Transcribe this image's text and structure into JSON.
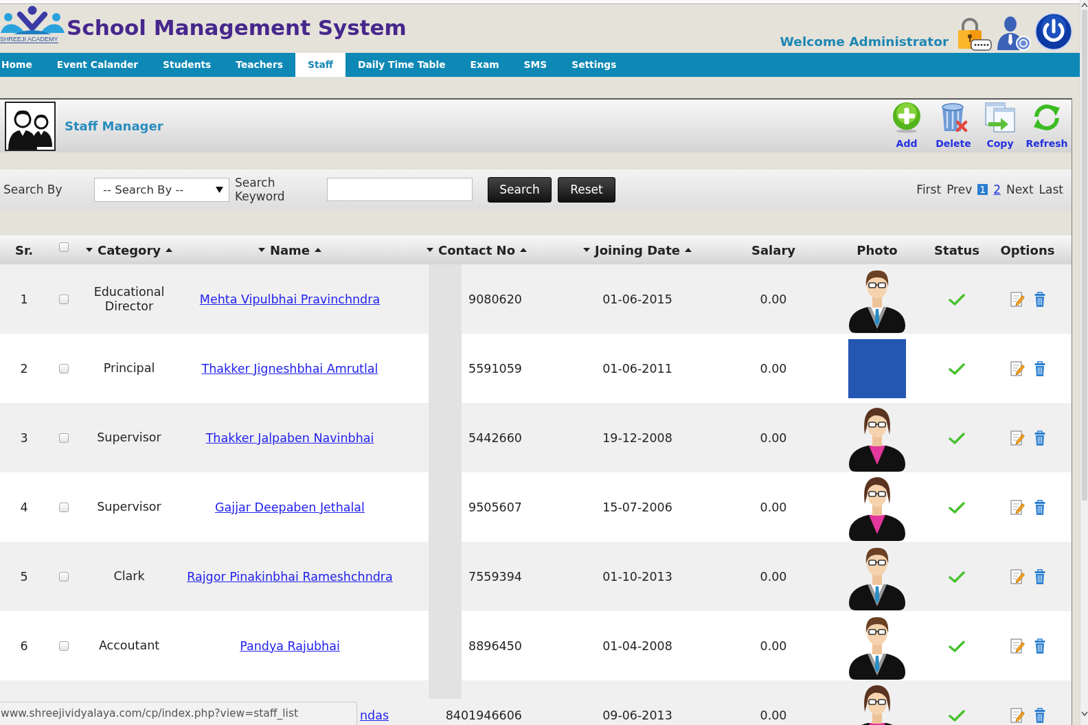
{
  "header": {
    "logo_text": "SHREEJI ACADEMY",
    "title": "School Management System",
    "welcome": "Welcome Administrator"
  },
  "nav": [
    {
      "label": "Home",
      "selected": false
    },
    {
      "label": "Event Calander",
      "selected": false
    },
    {
      "label": "Students",
      "selected": false
    },
    {
      "label": "Teachers",
      "selected": false
    },
    {
      "label": "Staff",
      "selected": true
    },
    {
      "label": "Daily Time Table",
      "selected": false
    },
    {
      "label": "Exam",
      "selected": false
    },
    {
      "label": "SMS",
      "selected": false
    },
    {
      "label": "Settings",
      "selected": false
    }
  ],
  "panel": {
    "title": "Staff Manager",
    "actions": [
      {
        "kind": "add",
        "label": "Add"
      },
      {
        "kind": "delete",
        "label": "Delete"
      },
      {
        "kind": "copy",
        "label": "Copy"
      },
      {
        "kind": "refresh",
        "label": "Refresh"
      }
    ]
  },
  "search": {
    "label": "Search By",
    "select": "-- Search By --",
    "keyword_label": "Search Keyword",
    "buttons": [
      {
        "kind": "search",
        "label": "Search"
      },
      {
        "kind": "reset",
        "label": "Reset"
      }
    ]
  },
  "pagination": {
    "first": "First",
    "prev": "Prev",
    "pages": [
      {
        "label": "1",
        "selected": true
      },
      {
        "label": "2",
        "selected": false
      }
    ],
    "next": "Next",
    "last": "Last"
  },
  "table": {
    "columns": [
      {
        "kind": "text",
        "label": "Sr.",
        "sortable": false
      },
      {
        "kind": "checkbox",
        "checked": false
      },
      {
        "kind": "text",
        "label": "Category",
        "sortable": true
      },
      {
        "kind": "text",
        "label": "Name",
        "sortable": true
      },
      {
        "kind": "text",
        "label": "Contact No",
        "sortable": true
      },
      {
        "kind": "text",
        "label": "Joining Date",
        "sortable": true
      },
      {
        "kind": "text",
        "label": "Salary",
        "sortable": false
      },
      {
        "kind": "text",
        "label": "Photo",
        "sortable": false
      },
      {
        "kind": "text",
        "label": "Status",
        "sortable": false
      },
      {
        "kind": "text",
        "label": "Options",
        "sortable": false
      }
    ],
    "rows": [
      {
        "sr": "1",
        "checked": false,
        "category": "Educational Director",
        "name": "Mehta Vipulbhai Pravinchndra",
        "covered": false,
        "contact": "9080620",
        "joining_date": "01-06-2015",
        "salary": "0.00",
        "photo": {
          "kind": "man"
        },
        "active": true
      },
      {
        "sr": "2",
        "checked": false,
        "category": "Principal",
        "name": "Thakker Jigneshbhai Amrutlal",
        "covered": false,
        "contact": "5591059",
        "joining_date": "01-06-2011",
        "salary": "0.00",
        "photo": {
          "kind": "picture"
        },
        "active": true
      },
      {
        "sr": "3",
        "checked": false,
        "category": "Supervisor",
        "name": "Thakker Jalpaben Navinbhai",
        "covered": false,
        "contact": "5442660",
        "joining_date": "19-12-2008",
        "salary": "0.00",
        "photo": {
          "kind": "woman"
        },
        "active": true
      },
      {
        "sr": "4",
        "checked": false,
        "category": "Supervisor",
        "name": "Gajjar Deepaben Jethalal",
        "covered": false,
        "contact": "9505607",
        "joining_date": "15-07-2006",
        "salary": "0.00",
        "photo": {
          "kind": "woman"
        },
        "active": true
      },
      {
        "sr": "5",
        "checked": false,
        "category": "Clark",
        "name": "Rajgor Pinakinbhai Rameshchndra",
        "covered": false,
        "contact": "7559394",
        "joining_date": "01-10-2013",
        "salary": "0.00",
        "photo": {
          "kind": "man"
        },
        "active": true
      },
      {
        "sr": "6",
        "checked": false,
        "category": "Accoutant",
        "name": "Pandya Rajubhai",
        "covered": false,
        "contact": "8896450",
        "joining_date": "01-04-2008",
        "salary": "0.00",
        "photo": {
          "kind": "man"
        },
        "active": true
      },
      {
        "name": "ndas",
        "covered": true,
        "contact": "8401946606",
        "joining_date": "09-06-2013",
        "salary": "0.00",
        "photo": {
          "kind": "woman"
        },
        "active": true
      }
    ]
  },
  "status_bar": {
    "url": "www.shreejividyalaya.com/cp/index.php?view=staff_list"
  }
}
